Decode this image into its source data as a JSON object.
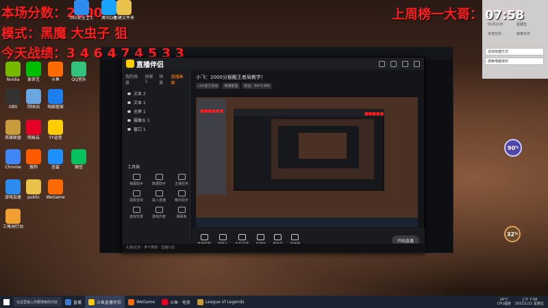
{
  "overlay": {
    "score": "本场分数：2000",
    "mode": "模式：黑魔 大虫子 狙",
    "record": "今天战绩：3 4 6 4 7 4 5 3 3",
    "rank": "上周榜一大哥：东网友"
  },
  "desktop_icons": [
    {
      "label": "360安全卫士",
      "color": "#2d8cf0"
    },
    {
      "label": "腾讯QQ",
      "color": "#1aa3ff"
    },
    {
      "label": "新建文件夹",
      "color": "#e8c24a"
    },
    {
      "label": "Nvidia",
      "color": "#76b900"
    },
    {
      "label": "爱奇艺",
      "color": "#00be06"
    },
    {
      "label": "斗鱼",
      "color": "#ff6a00"
    },
    {
      "label": "QQ音乐",
      "color": "#31c27c"
    },
    {
      "label": "OBS",
      "color": "#333333"
    },
    {
      "label": "回收站",
      "color": "#6aa6e0"
    },
    {
      "label": "电脑管家",
      "color": "#1b7ff0"
    },
    {
      "label": "英雄联盟",
      "color": "#c89b3c"
    },
    {
      "label": "网易云",
      "color": "#e60026"
    },
    {
      "label": "YY语音",
      "color": "#ffcc00"
    },
    {
      "label": "Chrome",
      "color": "#4285f4"
    },
    {
      "label": "搜狗",
      "color": "#ff5a00"
    },
    {
      "label": "迅雷",
      "color": "#1e90ff"
    },
    {
      "label": "微信",
      "color": "#07c160"
    },
    {
      "label": "游戏加速",
      "color": "#2d8cf0"
    },
    {
      "label": "public",
      "color": "#e8c24a"
    },
    {
      "label": "WeGame",
      "color": "#ff6a00"
    },
    {
      "label": "三角洲行动",
      "color": "#f0a030"
    }
  ],
  "window": {
    "app_name": "直播伴侣",
    "side_tabs": [
      "我的场景",
      "场景1",
      "场景",
      "直播画面"
    ],
    "layers": [
      "文本 2",
      "文本 1",
      "全屏 1",
      "摄像头 1",
      "窗口 1"
    ],
    "tools_title": "工具箱",
    "tools": [
      "弹幕助手",
      "数据助手",
      "主播任务",
      "视频音效",
      "投入直播",
      "精华助手",
      "虚拟背景",
      "游戏内容",
      "弹幕库"
    ],
    "room_title": "小飞：2000分掘醒王者局教学！",
    "room_tags": [
      "LOL官方活动",
      "英雄联盟",
      "粉丝：6471388"
    ],
    "controls": [
      "直播屏幕",
      "摄像头",
      "手机投屏",
      "多媒体",
      "麦克风",
      "扬声器"
    ],
    "start_button": "开始直播",
    "status": "礼物/任务 · 声卡推荐 · 直播公告"
  },
  "right_panel": {
    "clock": "07:58",
    "date": "01月21日",
    "week": "星期五",
    "items": [
      "本地文件",
      "转换文件",
      "添加快捷方式",
      "搜索电脑资料"
    ]
  },
  "badges": {
    "b1": "90",
    "b2": "32",
    "unit": "%"
  },
  "taskbar": {
    "search": "在这里输入你要搜索的内容",
    "items": [
      {
        "label": "直播",
        "color": "#3a7bd5"
      },
      {
        "label": "斗鱼直播伴侣",
        "color": "#ffcc00"
      },
      {
        "label": "WeGame",
        "color": "#ff6a00"
      },
      {
        "label": "斗鱼 · 电竞",
        "color": "#e60026"
      },
      {
        "label": "League of Legends",
        "color": "#c89b3c"
      }
    ],
    "temp": "24°C",
    "cpu": "CPU温度",
    "time": "上午 7:58",
    "date": "2022/1/21 星期五"
  }
}
